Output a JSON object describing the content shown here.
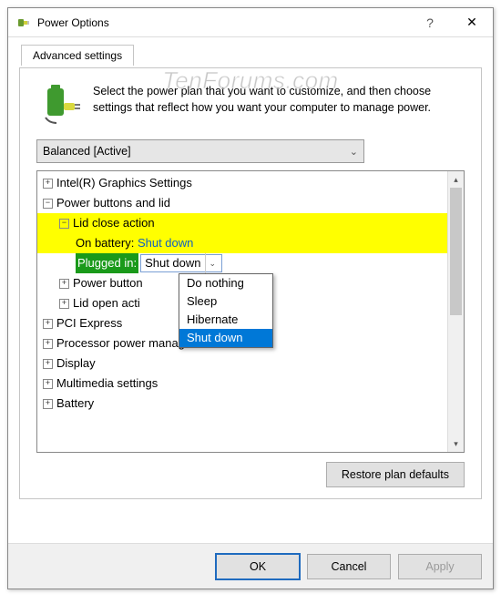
{
  "window": {
    "title": "Power Options",
    "help": "?",
    "close": "✕"
  },
  "tab": {
    "label": "Advanced settings"
  },
  "intro": "Select the power plan that you want to customize, and then choose settings that reflect how you want your computer to manage power.",
  "plan_select": {
    "value": "Balanced [Active]"
  },
  "tree": {
    "n0": "Intel(R) Graphics Settings",
    "n1": "Power buttons and lid",
    "n2": "Lid close action",
    "n3_label": "On battery:",
    "n3_value": "Shut down",
    "n4_label": "Plugged in:",
    "n4_value": "Shut down",
    "n5": "Power button",
    "n6": "Lid open acti",
    "n7": "PCI Express",
    "n8": "Processor power management",
    "n9": "Display",
    "n10": "Multimedia settings",
    "n11": "Battery"
  },
  "dropdown": {
    "o0": "Do nothing",
    "o1": "Sleep",
    "o2": "Hibernate",
    "o3": "Shut down"
  },
  "restore_btn": "Restore plan defaults",
  "footer": {
    "ok": "OK",
    "cancel": "Cancel",
    "apply": "Apply"
  },
  "watermark": "TenForums.com"
}
